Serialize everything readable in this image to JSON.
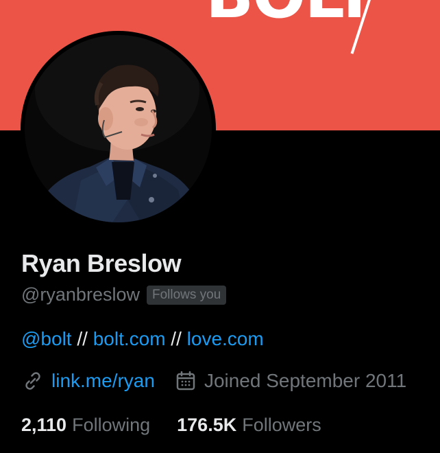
{
  "banner": {
    "logo_text": "BOLT",
    "color": "#ec5448"
  },
  "profile": {
    "name": "Ryan Breslow",
    "handle": "@ryanbreslow",
    "follows_you_badge": "Follows you",
    "bio": {
      "mention": "@bolt",
      "separator1": " // ",
      "link1": "bolt.com",
      "separator2": " // ",
      "link2": "love.com"
    },
    "website": "link.me/ryan",
    "joined": "Joined September 2011",
    "following_count": "2,110",
    "following_label": "Following",
    "followers_count": "176.5K",
    "followers_label": "Followers"
  },
  "icons": {
    "link": "link-icon",
    "calendar": "calendar-icon"
  },
  "colors": {
    "accent": "#1d9bf0",
    "muted": "#71767b",
    "text": "#e7e9ea",
    "background": "#000000"
  }
}
